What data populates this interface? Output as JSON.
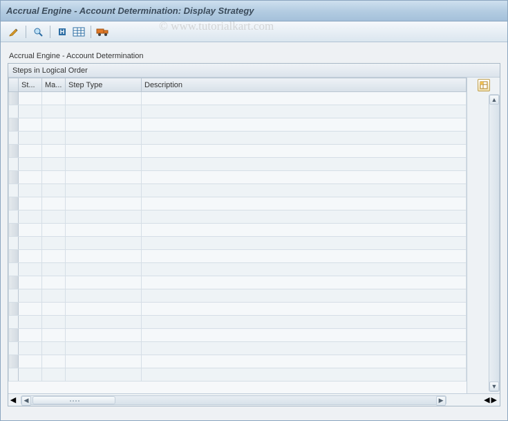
{
  "titlebar": {
    "title": "Accrual Engine - Account Determination: Display Strategy"
  },
  "toolbar": {
    "icons": [
      "pencil-icon",
      "find-icon",
      "info-icon",
      "table-icon",
      "truck-icon"
    ]
  },
  "watermark": "©  www.tutorialkart.com",
  "subtitle": "Accrual Engine - Account Determination",
  "grid": {
    "caption": "Steps in Logical Order",
    "columns": {
      "st": "St...",
      "ma": "Ma...",
      "type": "Step Type",
      "desc": "Description"
    },
    "rowCount": 22
  }
}
